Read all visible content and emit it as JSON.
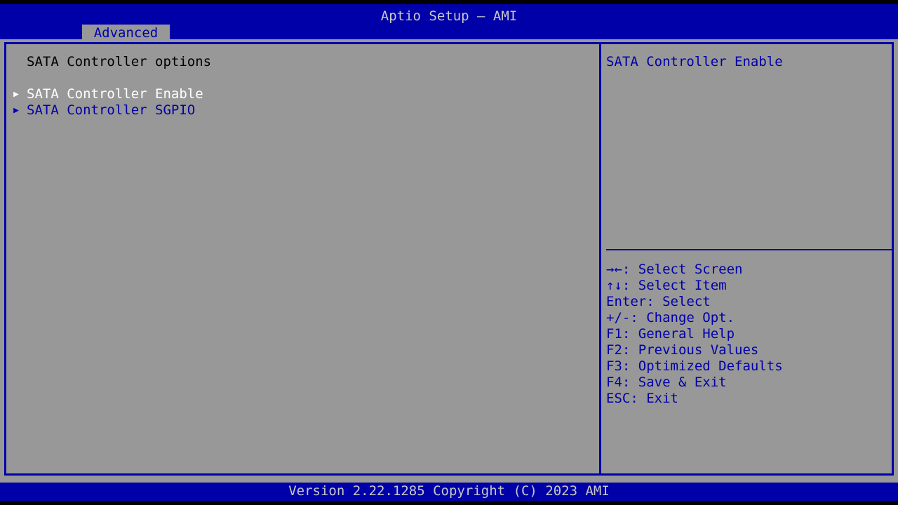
{
  "window": {
    "title": "Aptio Setup – AMI"
  },
  "menubar": {
    "tabs": [
      {
        "label": "Advanced",
        "active": true
      }
    ]
  },
  "left_pane": {
    "heading": "SATA Controller options",
    "items": [
      {
        "arrow_icon": "submenu-arrow-icon",
        "arrow_glyph": "▶",
        "label": "SATA Controller Enable",
        "selected": true
      },
      {
        "arrow_icon": "submenu-arrow-icon",
        "arrow_glyph": "▶",
        "label": "SATA Controller SGPIO",
        "selected": false
      }
    ]
  },
  "right_pane": {
    "help_title": "SATA Controller Enable",
    "legend": [
      {
        "keys": "→←",
        "text": ": Select Screen"
      },
      {
        "keys": "↑↓",
        "text": ": Select Item"
      },
      {
        "keys": "Enter",
        "text": ": Select"
      },
      {
        "keys": "+/-",
        "text": ": Change Opt."
      },
      {
        "keys": "F1",
        "text": ": General Help"
      },
      {
        "keys": "F2",
        "text": ": Previous Values"
      },
      {
        "keys": "F3",
        "text": ": Optimized Defaults"
      },
      {
        "keys": "F4",
        "text": ": Save & Exit"
      },
      {
        "keys": "ESC",
        "text": ": Exit"
      }
    ],
    "legend_lines": [
      "→←: Select Screen",
      "↑↓: Select Item",
      "Enter: Select",
      "+/-: Change Opt.",
      "F1: General Help",
      "F2: Previous Values",
      "F3: Optimized Defaults",
      "F4: Save & Exit",
      "ESC: Exit"
    ]
  },
  "footer": {
    "version_text": "Version 2.22.1285 Copyright (C) 2023 AMI"
  },
  "colors": {
    "background": "#989898",
    "accent_blue": "#0000a8",
    "selected_text": "#ffffff",
    "heading_text": "#000000",
    "bar_text": "#c8c8c8",
    "strip_black": "#000000"
  }
}
